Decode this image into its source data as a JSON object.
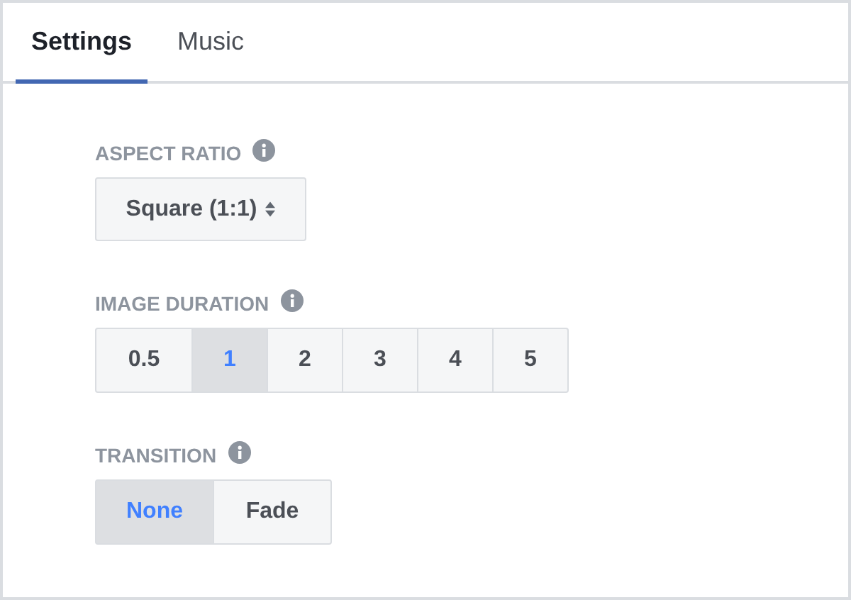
{
  "tabs": [
    {
      "label": "Settings",
      "selected": true
    },
    {
      "label": "Music",
      "selected": false
    }
  ],
  "aspect_ratio": {
    "label": "ASPECT RATIO",
    "value": "Square (1:1)"
  },
  "image_duration": {
    "label": "IMAGE DURATION",
    "options": [
      {
        "label": "0.5",
        "selected": false
      },
      {
        "label": "1",
        "selected": true
      },
      {
        "label": "2",
        "selected": false
      },
      {
        "label": "3",
        "selected": false
      },
      {
        "label": "4",
        "selected": false
      },
      {
        "label": "5",
        "selected": false
      }
    ]
  },
  "transition": {
    "label": "TRANSITION",
    "options": [
      {
        "label": "None",
        "selected": true
      },
      {
        "label": "Fade",
        "selected": false
      }
    ]
  }
}
